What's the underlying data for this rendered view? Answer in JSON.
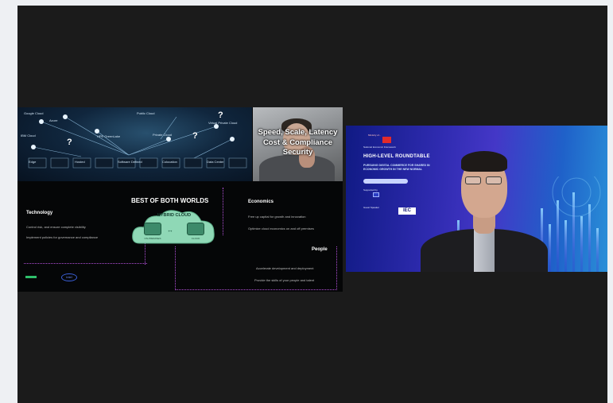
{
  "slide": {
    "net_labels": [
      "Google Cloud",
      "Azure",
      "IBM Cloud",
      "HPE GreenLake",
      "Private Cloud",
      "Virtual Private Cloud",
      "Edge",
      "Hosted",
      "Software Defined",
      "Colocation",
      "Data Center",
      "Public Cloud"
    ],
    "photo_title": "Speed, Scale, Latency Cost & Compliance Security",
    "center_title": "BEST OF BOTH WORLDS",
    "cloud_label": "HYBRID CLOUD",
    "cloud_left_caption": "ON-PREMISES",
    "cloud_right_caption": "CLOUD",
    "technology": {
      "title": "Technology",
      "lines": [
        "Control risk, and ensure complete visibility",
        "Implement policies for governance and compliance"
      ]
    },
    "economics": {
      "title": "Economics",
      "lines": [
        "Free up capital for growth and innovation",
        "Optimize cloud economics on and off premises"
      ]
    },
    "people": {
      "title": "People",
      "lines": [
        "Accelerate development and deployment",
        "Provide the skills of your people and talent"
      ]
    },
    "logo_right": "intel"
  },
  "speaker": {
    "pre_text": "Ministry of...",
    "org_text": "National Economic Framework",
    "roundtable_title": "HIGH-LEVEL ROUNDTABLE",
    "roundtable_subtitle": "PURSUING DIGITAL COMMERCE FOR SHARED IN ECONOMIC GROWTH IN THE NEW NORMAL",
    "mini_text": "Supported by",
    "guest_text": "Guest Speaker",
    "iec_label": "IEC"
  }
}
